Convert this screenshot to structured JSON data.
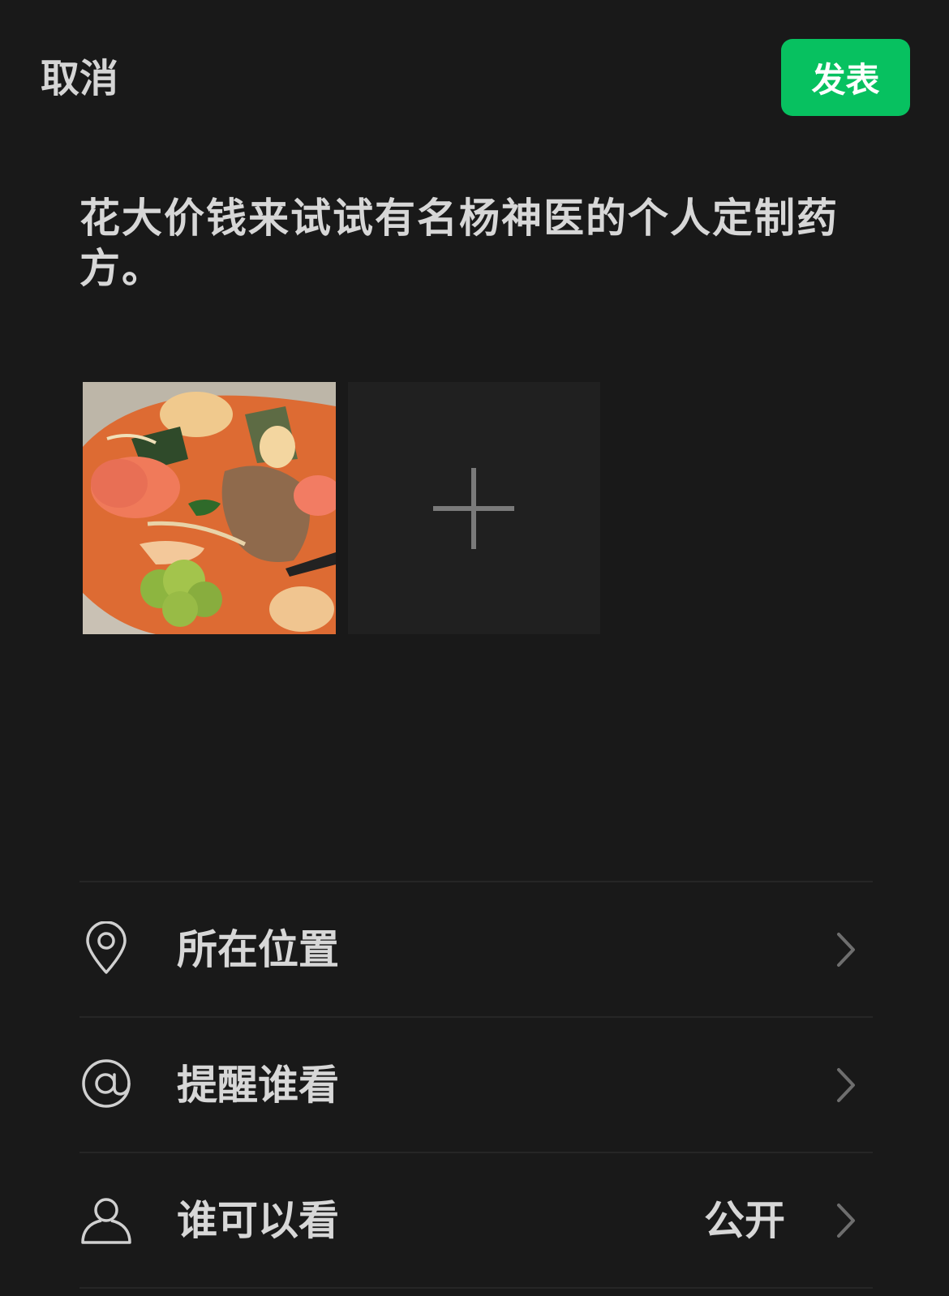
{
  "header": {
    "cancel_label": "取消",
    "publish_label": "发表",
    "publish_color": "#07c160"
  },
  "post": {
    "text": "花大价钱来试试有名杨神医的个人定制药方。"
  },
  "media": {
    "photo_count": 1,
    "photo_description": "food",
    "add_icon": "plus-icon"
  },
  "options": [
    {
      "label": "所在位置",
      "icon": "location-pin-icon",
      "value": ""
    },
    {
      "label": "提醒谁看",
      "icon": "at-sign-icon",
      "value": ""
    },
    {
      "label": "谁可以看",
      "icon": "person-icon",
      "value": "公开"
    }
  ],
  "theme": {
    "background": "#191919",
    "text": "#d7d7d7",
    "divider": "#262626"
  }
}
